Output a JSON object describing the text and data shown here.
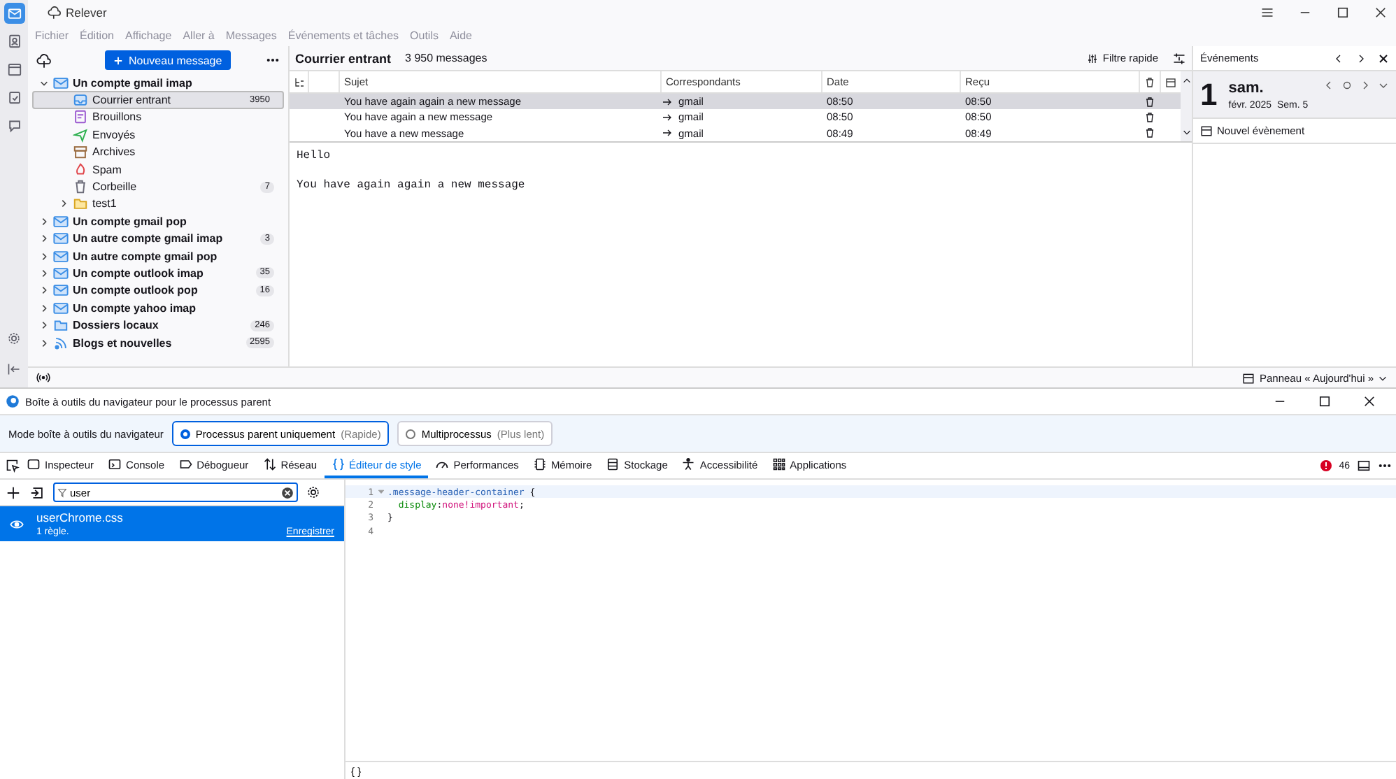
{
  "mail": {
    "title": "Relever",
    "spaces": [
      {
        "kind": "mail",
        "selected": true
      },
      {
        "kind": "contacts",
        "selected": false
      },
      {
        "kind": "calendar",
        "selected": false
      },
      {
        "kind": "tasks",
        "selected": false
      },
      {
        "kind": "chat",
        "selected": false
      }
    ],
    "menu": [
      "Fichier",
      "Édition",
      "Affichage",
      "Aller à",
      "Messages",
      "Événements et tâches",
      "Outils",
      "Aide"
    ],
    "new_message": "Nouveau message",
    "folders": [
      {
        "name": "Un compte gmail imap",
        "kind": "account",
        "expanded": true,
        "children": [
          {
            "name": "Courrier entrant",
            "kind": "inbox",
            "count": "3950",
            "selected": true
          },
          {
            "name": "Brouillons",
            "kind": "drafts",
            "selected": false
          },
          {
            "name": "Envoyés",
            "kind": "sent",
            "selected": false
          },
          {
            "name": "Archives",
            "kind": "archives",
            "selected": false
          },
          {
            "name": "Spam",
            "kind": "spam",
            "selected": false
          },
          {
            "name": "Corbeille",
            "kind": "trash",
            "count": "7",
            "selected": false
          },
          {
            "name": "test1",
            "kind": "folder",
            "expanded": false,
            "selected": false
          }
        ]
      },
      {
        "name": "Un compte gmail pop",
        "kind": "account",
        "expanded": false
      },
      {
        "name": "Un autre compte gmail imap",
        "kind": "account",
        "expanded": false,
        "count": "3"
      },
      {
        "name": "Un autre compte gmail pop",
        "kind": "account",
        "expanded": false
      },
      {
        "name": "Un compte outlook imap",
        "kind": "account",
        "expanded": false,
        "count": "35"
      },
      {
        "name": "Un compte outlook pop",
        "kind": "account",
        "expanded": false,
        "count": "16"
      },
      {
        "name": "Un compte yahoo imap",
        "kind": "account",
        "expanded": false
      },
      {
        "name": "Dossiers locaux",
        "kind": "local",
        "expanded": false,
        "count": "246"
      },
      {
        "name": "Blogs et nouvelles",
        "kind": "rss",
        "expanded": false,
        "count": "2595"
      }
    ],
    "message_list": {
      "folder": "Courrier entrant",
      "count": "3 950 messages",
      "quick_filter": "Filtre rapide",
      "columns": [
        "Sujet",
        "Correspondants",
        "Date",
        "Reçu"
      ],
      "rows": [
        {
          "subject": "You have again again a new message",
          "correspondent": "gmail",
          "date": "08:50",
          "received": "08:50",
          "selected": true
        },
        {
          "subject": "You have again a new message",
          "correspondent": "gmail",
          "date": "08:50",
          "received": "08:50",
          "selected": false
        },
        {
          "subject": "You have a new message",
          "correspondent": "gmail",
          "date": "08:49",
          "received": "08:49",
          "selected": false
        }
      ]
    },
    "preview": [
      "Hello",
      "You have again again a new message"
    ],
    "events": {
      "title": "Événements",
      "day": "1",
      "weekday": "sam.",
      "month": "févr. 2025",
      "week": "Sem. 5",
      "new_event": "Nouvel évènement"
    },
    "status_bar": {
      "today_pane": "Panneau « Aujourd'hui »"
    }
  },
  "devtools": {
    "title": "Boîte à outils du navigateur pour le processus parent",
    "mode_label": "Mode boîte à outils du navigateur",
    "modes": [
      {
        "label": "Processus parent uniquement",
        "hint": "(Rapide)",
        "selected": true
      },
      {
        "label": "Multiprocessus",
        "hint": "(Plus lent)",
        "selected": false
      }
    ],
    "tabs": [
      {
        "label": "Inspecteur",
        "kind": "inspector",
        "selected": false
      },
      {
        "label": "Console",
        "kind": "console",
        "selected": false
      },
      {
        "label": "Débogueur",
        "kind": "debugger",
        "selected": false
      },
      {
        "label": "Réseau",
        "kind": "network",
        "selected": false
      },
      {
        "label": "Éditeur de style",
        "kind": "style",
        "selected": true
      },
      {
        "label": "Performances",
        "kind": "performance",
        "selected": false
      },
      {
        "label": "Mémoire",
        "kind": "memory",
        "selected": false
      },
      {
        "label": "Stockage",
        "kind": "storage",
        "selected": false
      },
      {
        "label": "Accessibilité",
        "kind": "accessibility",
        "selected": false
      },
      {
        "label": "Applications",
        "kind": "applications",
        "selected": false
      }
    ],
    "error_count": "46",
    "filter": {
      "value": "user"
    },
    "stylesheets": [
      {
        "name": "userChrome.css",
        "rules": "1 règle.",
        "save": "Enregistrer",
        "selected": true
      }
    ],
    "code": [
      {
        "number": "1",
        "tokens": [
          {
            "text": ".message-header-container",
            "kind": "selector"
          },
          {
            "text": " {",
            "kind": "punct"
          }
        ]
      },
      {
        "number": "2",
        "tokens": [
          {
            "text": "  display",
            "kind": "property"
          },
          {
            "text": ":",
            "kind": "punct"
          },
          {
            "text": "none!important",
            "kind": "value"
          },
          {
            "text": ";",
            "kind": "punct"
          }
        ]
      },
      {
        "number": "3",
        "tokens": [
          {
            "text": "}",
            "kind": "punct"
          }
        ]
      },
      {
        "number": "4"
      }
    ],
    "pretty_print": "{ }"
  }
}
